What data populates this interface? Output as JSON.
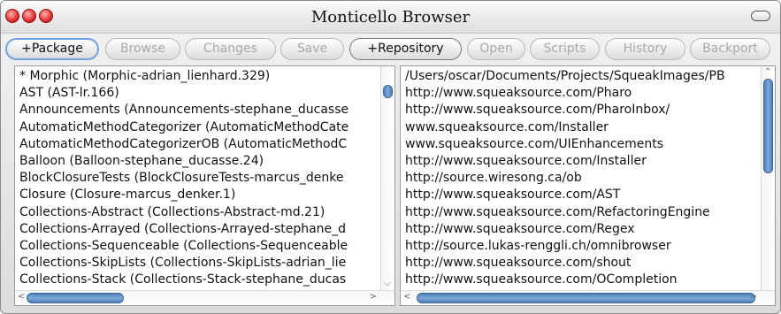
{
  "window": {
    "title": "Monticello Browser"
  },
  "toolbar": {
    "buttons": [
      {
        "label": "+Package",
        "enabled": true
      },
      {
        "label": "Browse",
        "enabled": false
      },
      {
        "label": "Changes",
        "enabled": false
      },
      {
        "label": "Save",
        "enabled": false
      },
      {
        "label": "+Repository",
        "enabled": true
      },
      {
        "label": "Open",
        "enabled": false
      },
      {
        "label": "Scripts",
        "enabled": false
      },
      {
        "label": "History",
        "enabled": false
      },
      {
        "label": "Backport",
        "enabled": false
      }
    ]
  },
  "packages": {
    "items": [
      "* Morphic (Morphic-adrian_lienhard.329)",
      "AST (AST-lr.166)",
      "Announcements (Announcements-stephane_ducasse",
      "AutomaticMethodCategorizer (AutomaticMethodCate",
      "AutomaticMethodCategorizerOB (AutomaticMethodC",
      "Balloon (Balloon-stephane_ducasse.24)",
      "BlockClosureTests (BlockClosureTests-marcus_denke",
      "Closure (Closure-marcus_denker.1)",
      "Collections-Abstract (Collections-Abstract-md.21)",
      "Collections-Arrayed (Collections-Arrayed-stephane_d",
      "Collections-Sequenceable (Collections-Sequenceable",
      "Collections-SkipLists (Collections-SkipLists-adrian_lie",
      "Collections-Stack (Collections-Stack-stephane_ducas"
    ]
  },
  "repositories": {
    "items": [
      "/Users/oscar/Documents/Projects/SqueakImages/PB",
      "http://www.squeaksource.com/Pharo",
      "http://www.squeaksource.com/PharoInbox/",
      "www.squeaksource.com/Installer",
      "www.squeaksource.com/UIEnhancements",
      "http://www.squeaksource.com/Installer",
      "http://source.wiresong.ca/ob",
      "http://www.squeaksource.com/AST",
      "http://www.squeaksource.com/RefactoringEngine",
      "http://www.squeaksource.com/Regex",
      "http://source.lukas-renggli.ch/omnibrowser",
      "http://www.squeaksource.com/shout",
      "http://www.squeaksource.com/OCompletion"
    ]
  },
  "icons": {
    "close": "close-icon",
    "minimize": "minimize-icon",
    "maximize": "maximize-icon",
    "collapse": "collapse-icon",
    "scroll_up": "chevron-up-icon",
    "scroll_down": "chevron-down-icon",
    "scroll_left": "chevron-left-icon",
    "scroll_right": "chevron-right-icon"
  },
  "colors": {
    "scroll_thumb": "#5b8bc4",
    "focus_ring": "#6fa3df",
    "traffic_red": "#e03030"
  }
}
